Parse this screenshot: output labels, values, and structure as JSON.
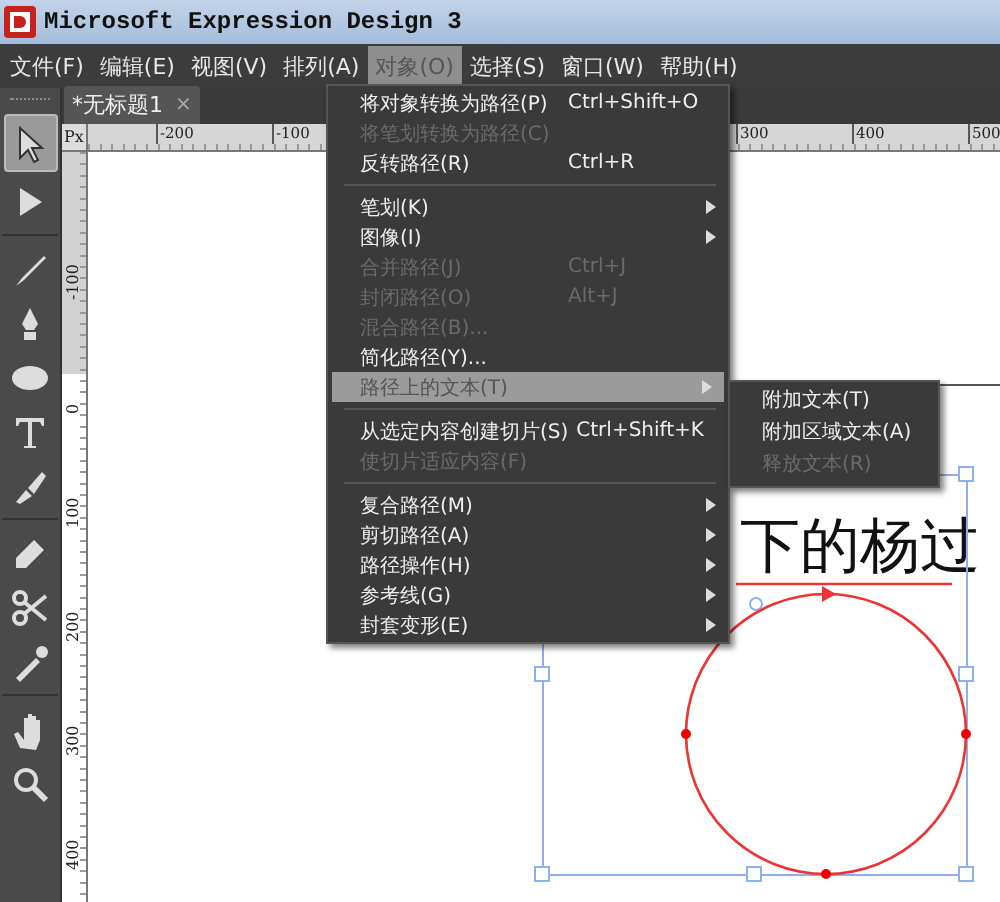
{
  "window": {
    "title": "Microsoft Expression Design 3"
  },
  "menubar": [
    {
      "label": "文件(F)",
      "selected": false
    },
    {
      "label": "编辑(E)",
      "selected": false
    },
    {
      "label": "视图(V)",
      "selected": false
    },
    {
      "label": "排列(A)",
      "selected": false
    },
    {
      "label": "对象(O)",
      "selected": true
    },
    {
      "label": "选择(S)",
      "selected": false
    },
    {
      "label": "窗口(W)",
      "selected": false
    },
    {
      "label": "帮助(H)",
      "selected": false
    }
  ],
  "document_tab": {
    "label": "*无标题1",
    "close": "×"
  },
  "tools": [
    {
      "kind": "select",
      "selected": true
    },
    {
      "kind": "direct",
      "selected": false
    },
    {
      "kind": "brush",
      "selected": false
    },
    {
      "kind": "pen",
      "selected": false
    },
    {
      "kind": "ellipse",
      "selected": false
    },
    {
      "kind": "text",
      "selected": false
    },
    {
      "kind": "knife",
      "selected": false
    },
    {
      "kind": "eraser",
      "selected": false
    },
    {
      "kind": "scissors",
      "selected": false
    },
    {
      "kind": "eyedropper",
      "selected": false
    },
    {
      "kind": "hand",
      "selected": false
    },
    {
      "kind": "zoom",
      "selected": false
    }
  ],
  "ruler": {
    "unit": "Px",
    "horizontal": [
      "-200",
      "-100",
      "300",
      "400",
      "500"
    ],
    "vertical": [
      "-100",
      "0",
      "100",
      "200",
      "300",
      "400"
    ]
  },
  "canvas": {
    "text": "下的杨过"
  },
  "menu": [
    {
      "kind": "item",
      "label": "将对象转换为路径(P)",
      "shortcut": "Ctrl+Shift+O",
      "disabled": false,
      "submenu": false,
      "selected": false
    },
    {
      "kind": "item",
      "label": "将笔划转换为路径(C)",
      "disabled": true,
      "submenu": false,
      "selected": false
    },
    {
      "kind": "item",
      "label": "反转路径(R)",
      "shortcut": "Ctrl+R",
      "disabled": false,
      "submenu": false,
      "selected": false
    },
    {
      "kind": "separator"
    },
    {
      "kind": "item",
      "label": "笔划(K)",
      "disabled": false,
      "submenu": true,
      "selected": false
    },
    {
      "kind": "item",
      "label": "图像(I)",
      "disabled": false,
      "submenu": true,
      "selected": false
    },
    {
      "kind": "item",
      "label": "合并路径(J)",
      "shortcut": "Ctrl+J",
      "disabled": true,
      "submenu": false,
      "selected": false
    },
    {
      "kind": "item",
      "label": "封闭路径(O)",
      "shortcut": "Alt+J",
      "disabled": true,
      "submenu": false,
      "selected": false
    },
    {
      "kind": "item",
      "label": "混合路径(B)...",
      "disabled": true,
      "submenu": false,
      "selected": false
    },
    {
      "kind": "item",
      "label": "简化路径(Y)...",
      "disabled": false,
      "submenu": false,
      "selected": false
    },
    {
      "kind": "item",
      "label": "路径上的文本(T)",
      "disabled": false,
      "submenu": true,
      "selected": true
    },
    {
      "kind": "separator"
    },
    {
      "kind": "item",
      "label": "从选定内容创建切片(S)",
      "shortcut": "Ctrl+Shift+K",
      "disabled": false,
      "submenu": false,
      "selected": false
    },
    {
      "kind": "item",
      "label": "使切片适应内容(F)",
      "disabled": true,
      "submenu": false,
      "selected": false
    },
    {
      "kind": "separator"
    },
    {
      "kind": "item",
      "label": "复合路径(M)",
      "disabled": false,
      "submenu": true,
      "selected": false
    },
    {
      "kind": "item",
      "label": "剪切路径(A)",
      "disabled": false,
      "submenu": true,
      "selected": false
    },
    {
      "kind": "item",
      "label": "路径操作(H)",
      "disabled": false,
      "submenu": true,
      "selected": false
    },
    {
      "kind": "item",
      "label": "参考线(G)",
      "disabled": false,
      "submenu": true,
      "selected": false
    },
    {
      "kind": "item",
      "label": "封套变形(E)",
      "disabled": false,
      "submenu": true,
      "selected": false
    }
  ],
  "submenu": [
    {
      "label": "附加文本(T)",
      "disabled": false
    },
    {
      "label": "附加区域文本(A)",
      "disabled": false
    },
    {
      "label": "释放文本(R)",
      "disabled": true
    }
  ]
}
